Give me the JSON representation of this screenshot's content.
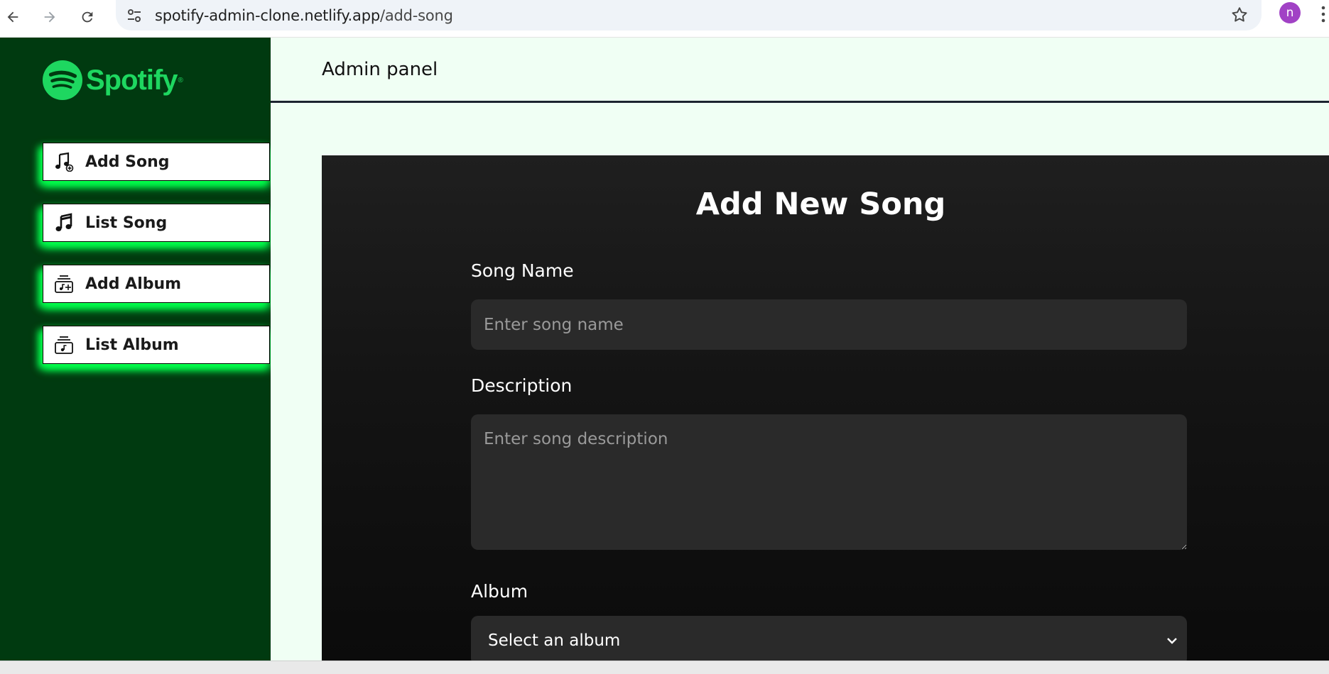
{
  "browser": {
    "url_host": "spotify-admin-clone.netlify.app",
    "url_path": "/add-song",
    "profile_initial": "n"
  },
  "sidebar": {
    "logo_text": "Spotify",
    "logo_mark": "®",
    "items": [
      {
        "label": "Add Song",
        "icon": "music-note-add-icon"
      },
      {
        "label": "List Song",
        "icon": "music-note-icon"
      },
      {
        "label": "Add Album",
        "icon": "album-add-icon"
      },
      {
        "label": "List Album",
        "icon": "album-list-icon"
      }
    ]
  },
  "header": {
    "title": "Admin panel"
  },
  "form": {
    "title": "Add New Song",
    "song_name_label": "Song Name",
    "song_name_placeholder": "Enter song name",
    "description_label": "Description",
    "description_placeholder": "Enter song description",
    "album_label": "Album",
    "album_selected": "Select an album"
  },
  "colors": {
    "sidebar_bg": "#003a10",
    "brand_green": "#1ed760",
    "glow": "#00ff4c",
    "main_bg": "#f0fff4",
    "card_bg": "#1f1f1f",
    "input_bg": "#2a2a2a"
  }
}
